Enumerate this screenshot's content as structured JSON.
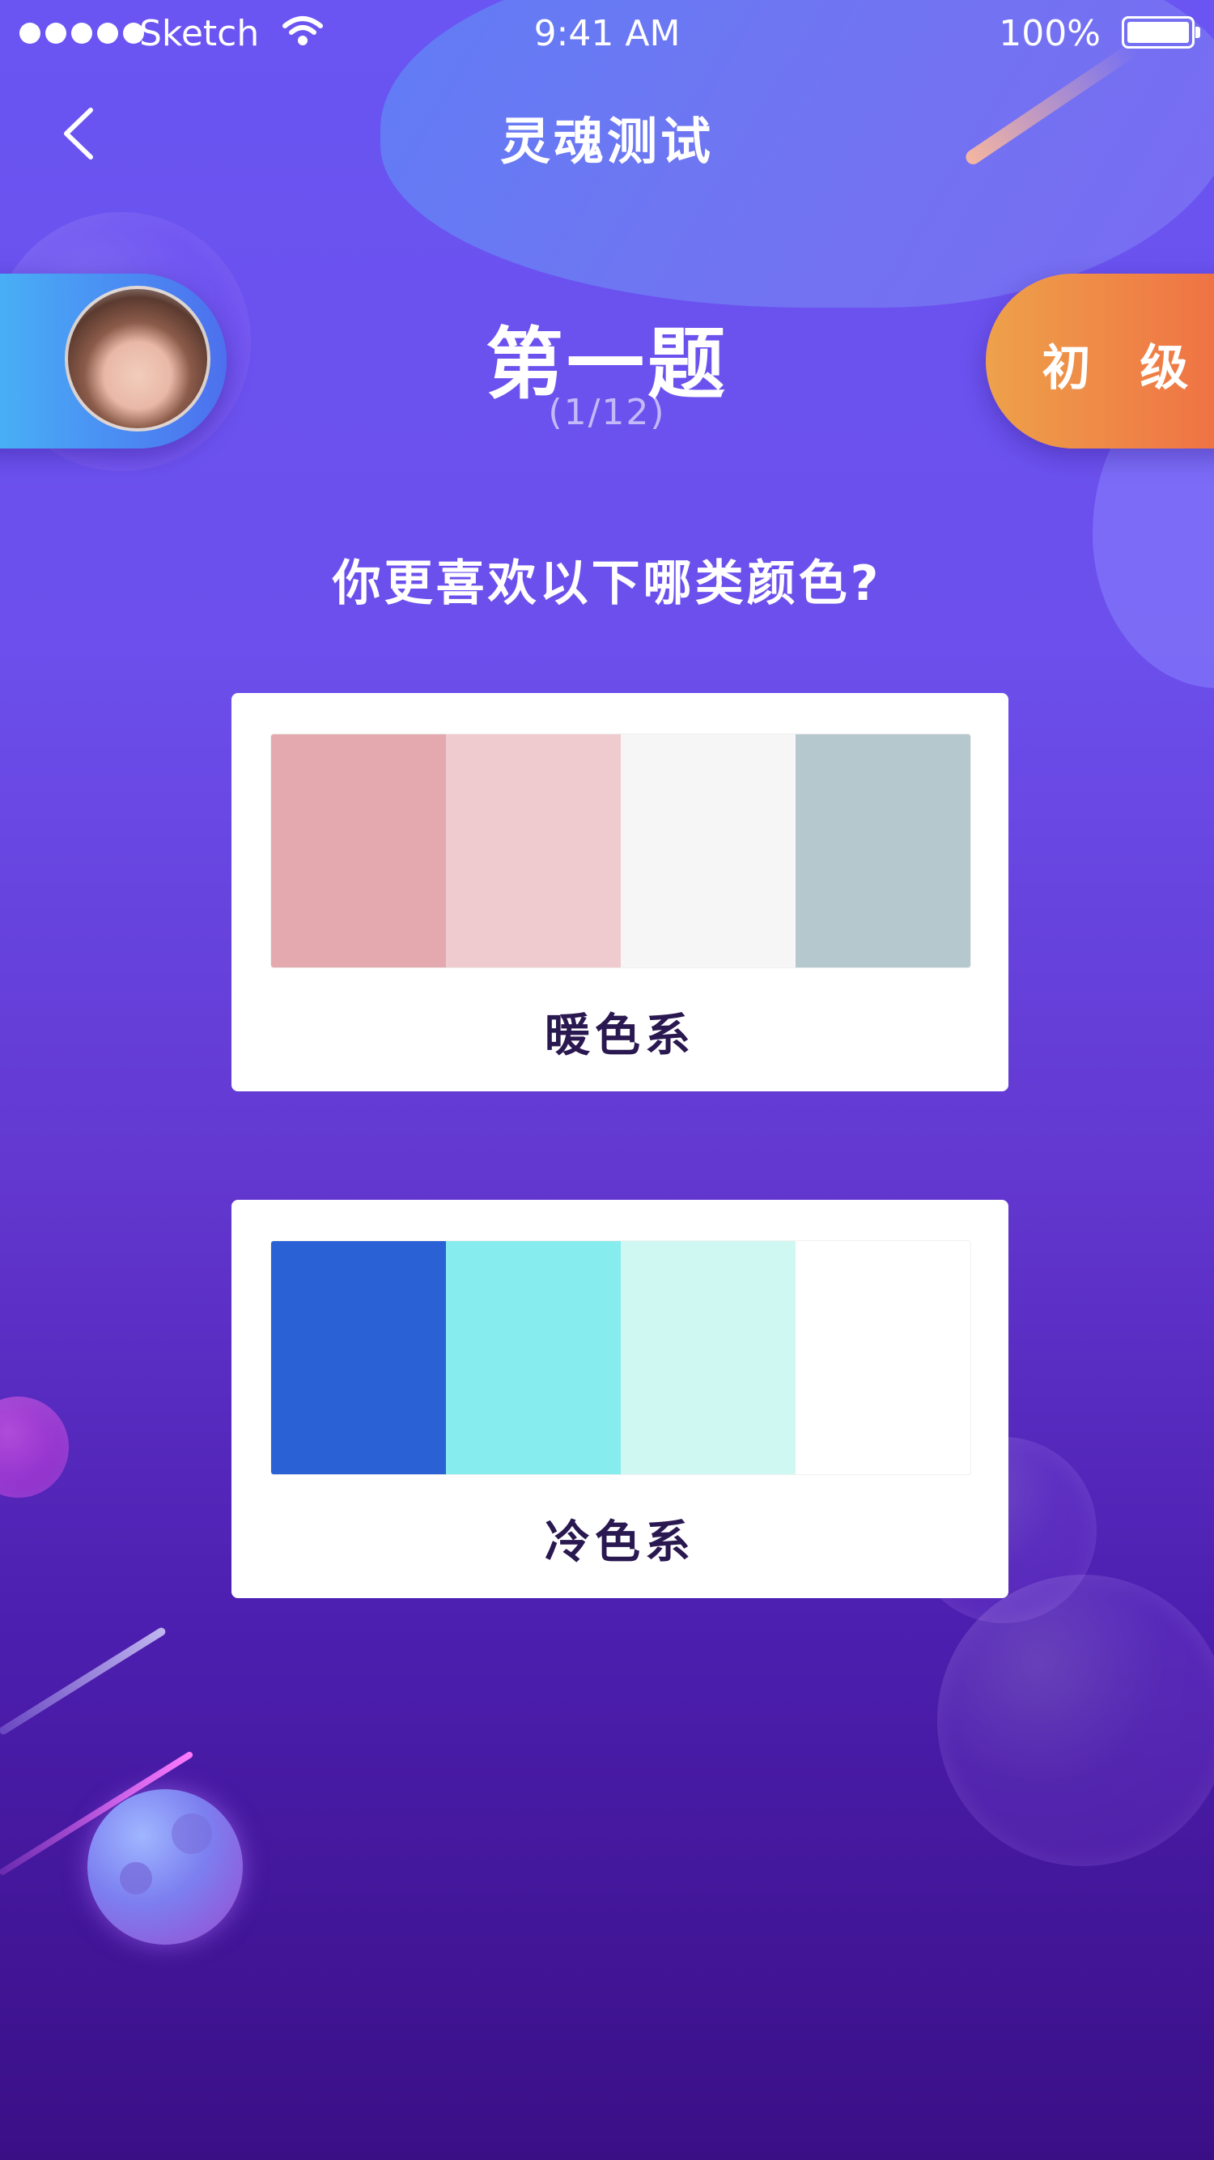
{
  "status_bar": {
    "carrier": "Sketch",
    "time": "9:41 AM",
    "battery": "100%"
  },
  "nav": {
    "title": "灵魂测试",
    "back_icon": "chevron-left-icon"
  },
  "quiz": {
    "question_number": "第一题",
    "progress": "(1/12)",
    "level": "初 级",
    "question": "你更喜欢以下哪类颜色?"
  },
  "options": [
    {
      "label": "暖色系",
      "colors": [
        "#e4a9ae",
        "#efcbcf",
        "#f6f6f6",
        "#b5c8cd"
      ]
    },
    {
      "label": "冷色系",
      "colors": [
        "#2a62d6",
        "#87ecee",
        "#cff8f2",
        "#ffffff"
      ]
    }
  ]
}
